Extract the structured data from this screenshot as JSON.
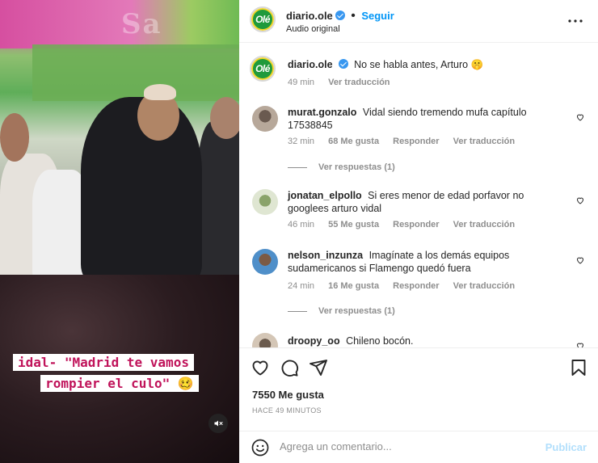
{
  "video": {
    "caption_line1": "idal- \"Madrid te vamos",
    "caption_line2": "rompier el culo\" 🥴",
    "mute_icon": "speaker-muted-icon"
  },
  "header": {
    "username": "diario.ole",
    "follow_label": "Seguir",
    "audio_label": "Audio original",
    "logo_text": "Olé"
  },
  "caption_comment": {
    "username": "diario.ole",
    "text": "No se habla antes, Arturo 🤫",
    "time": "49 min",
    "translate": "Ver traducción"
  },
  "comments": [
    {
      "username": "murat.gonzalo",
      "text": "Vidal siendo tremendo mufa capítulo 17538845",
      "time": "32 min",
      "likes": "68 Me gusta",
      "reply": "Responder",
      "translate": "Ver traducción",
      "view_replies": "Ver respuestas (1)"
    },
    {
      "username": "jonatan_elpollo",
      "text": "Si eres menor de edad porfavor no googlees arturo vidal",
      "time": "46 min",
      "likes": "55 Me gusta",
      "reply": "Responder",
      "translate": "Ver traducción"
    },
    {
      "username": "nelson_inzunza",
      "text": "Imagínate a los demás equipos sudamericanos si Flamengo quedó fuera",
      "time": "24 min",
      "likes": "16 Me gusta",
      "reply": "Responder",
      "translate": "Ver traducción",
      "view_replies": "Ver respuestas (1)"
    },
    {
      "username": "droopy_oo",
      "text": "Chileno bocón."
    }
  ],
  "actions": {
    "likes": "7550 Me gusta",
    "time_ago": "HACE 49 MINUTOS"
  },
  "add_comment": {
    "placeholder": "Agrega un comentario...",
    "publish": "Publicar"
  },
  "colors": {
    "accent": "#0095f6",
    "publish_disabled": "#b2dffc",
    "muted_text": "#8e8e8e",
    "caption_text": "#c0135a"
  }
}
